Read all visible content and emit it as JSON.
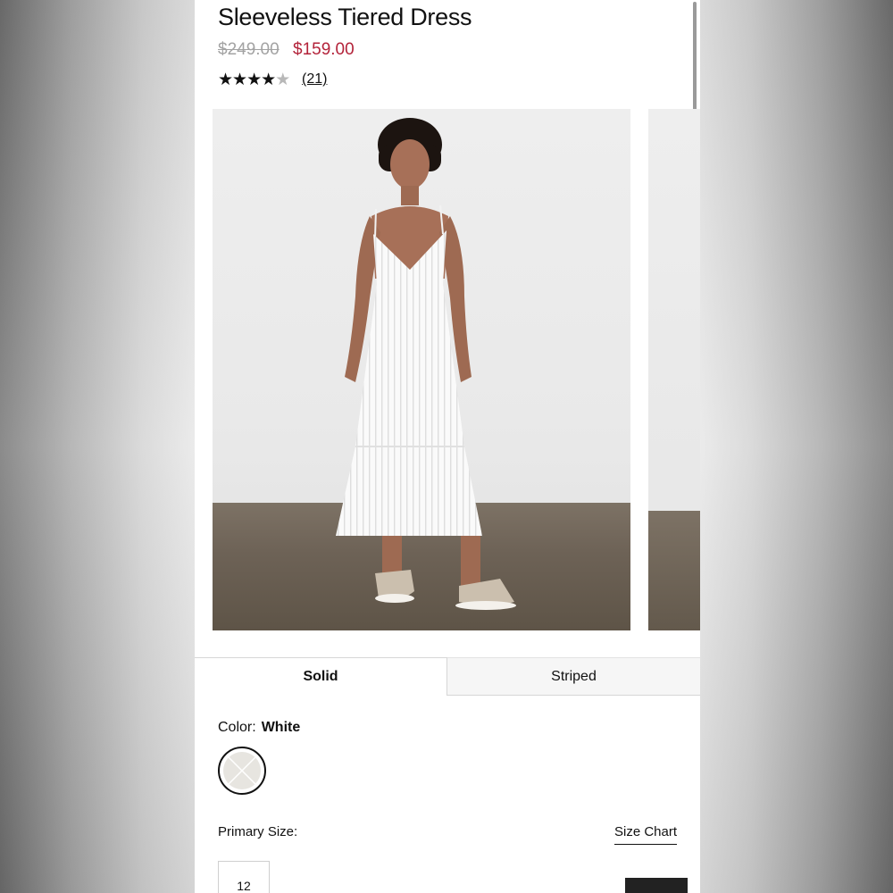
{
  "product": {
    "title": "Sleeveless Tiered Dress",
    "price_original": "$249.00",
    "price_sale": "$159.00",
    "rating_stars": 4.5,
    "review_count": "(21)",
    "sale_color": "#b3233a"
  },
  "gallery": {
    "image_alt": "Model wearing white sleeveless tiered dress",
    "dot_count": 4,
    "active_index": 0
  },
  "pattern_tabs": [
    {
      "label": "Solid",
      "selected": true
    },
    {
      "label": "Striped",
      "selected": false
    }
  ],
  "color": {
    "label": "Color:",
    "value": "White"
  },
  "size": {
    "label": "Primary Size:",
    "chart_link": "Size Chart",
    "options": [
      "12"
    ]
  }
}
